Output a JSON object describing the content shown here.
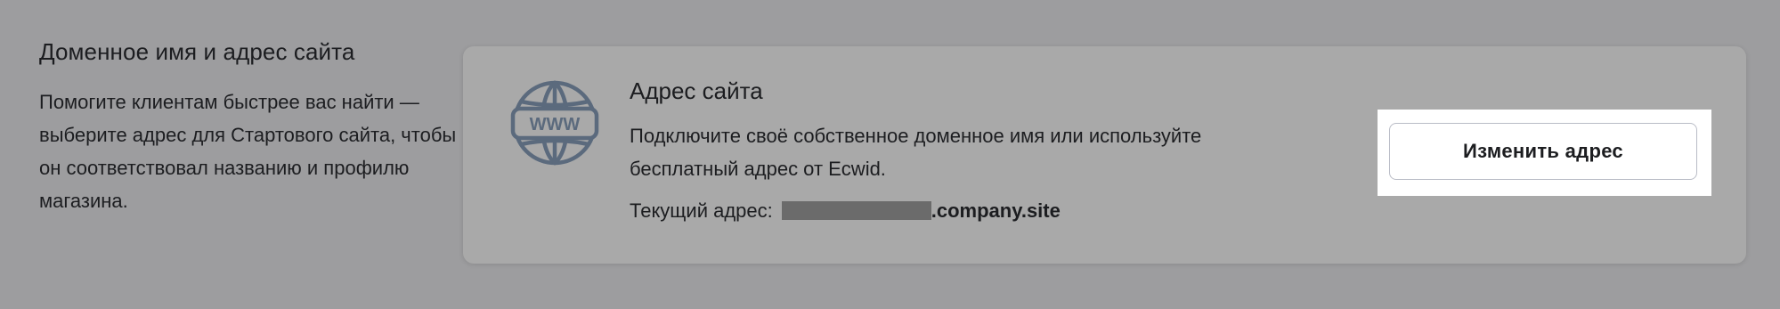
{
  "section": {
    "title": "Доменное имя и адрес сайта",
    "description": "Помогите клиентам быстрее вас найти — выберите адрес для Стартового сайта, чтобы он соответствовал названию и профилю магазина."
  },
  "card": {
    "icon": "www-globe-icon",
    "title": "Адрес сайта",
    "description": "Подключите своё собственное доменное имя или используйте бесплатный адрес от Ecwid.",
    "current_label": "Текущий адрес:",
    "current_domain_suffix": ".company.site"
  },
  "actions": {
    "change_address_label": "Изменить адрес"
  },
  "colors": {
    "background": "#9d9d9f",
    "card_background": "#a9a9a9",
    "icon_color": "#5b6a7d",
    "text_color": "#1c1d20",
    "button_border": "#b9bcc6"
  }
}
